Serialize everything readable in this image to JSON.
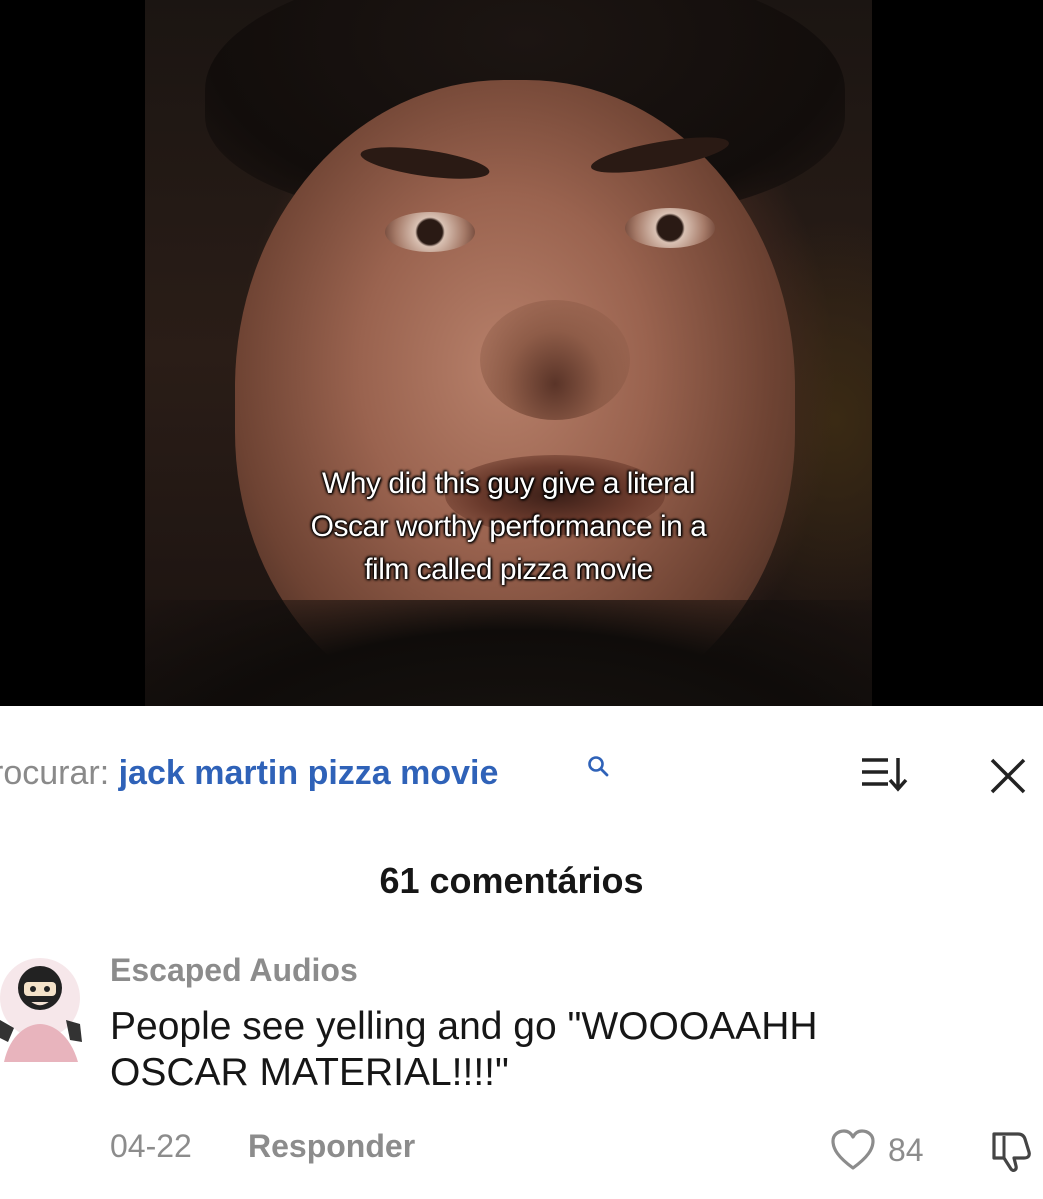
{
  "video": {
    "caption_lines": [
      "Why did this guy give a literal",
      "Oscar worthy performance in a",
      "film called pizza movie"
    ]
  },
  "search": {
    "prefix": "rocurar: ",
    "query": "jack martin pizza movie",
    "icons": [
      "search-icon",
      "sort-icon",
      "close-icon"
    ],
    "query_color": "#2f62b8"
  },
  "comments": {
    "count_label": "61 comentários"
  },
  "comment": {
    "username": "Escaped Audios",
    "text_lines": [
      "People see yelling and go \"WOOOAAHH",
      "OSCAR MATERIAL!!!!\""
    ],
    "date": "04-22",
    "reply_label": "Responder",
    "like_count": "84"
  }
}
